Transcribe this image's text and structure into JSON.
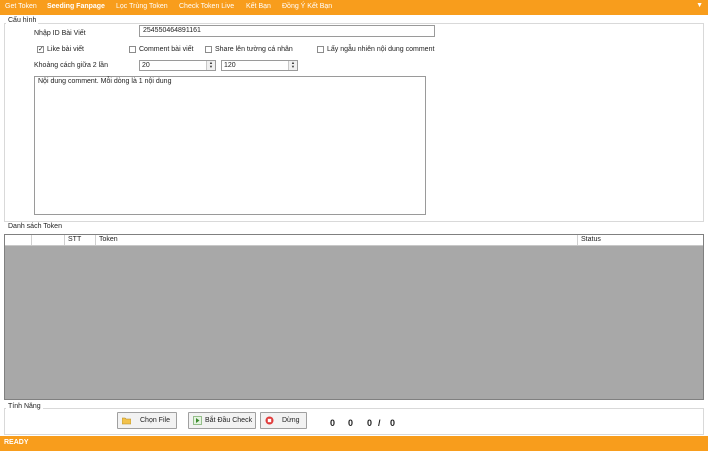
{
  "menu": {
    "tabs": [
      {
        "label": "Get Token"
      },
      {
        "label": "Seeding Fanpage"
      },
      {
        "label": "Lọc Trùng Token"
      },
      {
        "label": "Check Token Live"
      },
      {
        "label": "Kết Bạn"
      },
      {
        "label": "Đồng Ý Kết Bạn"
      }
    ],
    "arrow": "▼"
  },
  "config": {
    "group_title": "Cấu hình",
    "post_id_label": "Nhập ID Bài Viết",
    "post_id_value": "254550464891161",
    "options": [
      {
        "label": "Like bài viết",
        "checked": true
      },
      {
        "label": "Comment bài viết",
        "checked": false
      },
      {
        "label": "Share lên tường cá nhân",
        "checked": false
      },
      {
        "label": "Lấy ngẫu nhiên nội dung comment",
        "checked": false
      }
    ],
    "interval_label": "Khoảng cách giữa 2 lần",
    "interval_min": "20",
    "interval_max": "120",
    "comment_placeholder": "Nội dung comment. Mỗi dòng là 1 nội dung"
  },
  "tokens": {
    "group_title": "Danh sách Token",
    "columns": [
      "",
      "",
      "STT",
      "Token",
      "Status"
    ]
  },
  "features": {
    "group_title": "Tính Năng",
    "choose_file": "Chọn File",
    "start_check": "Bắt Đầu Check",
    "stop": "Dừng",
    "counters": [
      "0",
      "0",
      "0",
      "/",
      "0"
    ]
  },
  "status": {
    "text": "READY"
  },
  "colors": {
    "accent": "#f89d1c",
    "grid_bg": "#a8a8a8"
  }
}
